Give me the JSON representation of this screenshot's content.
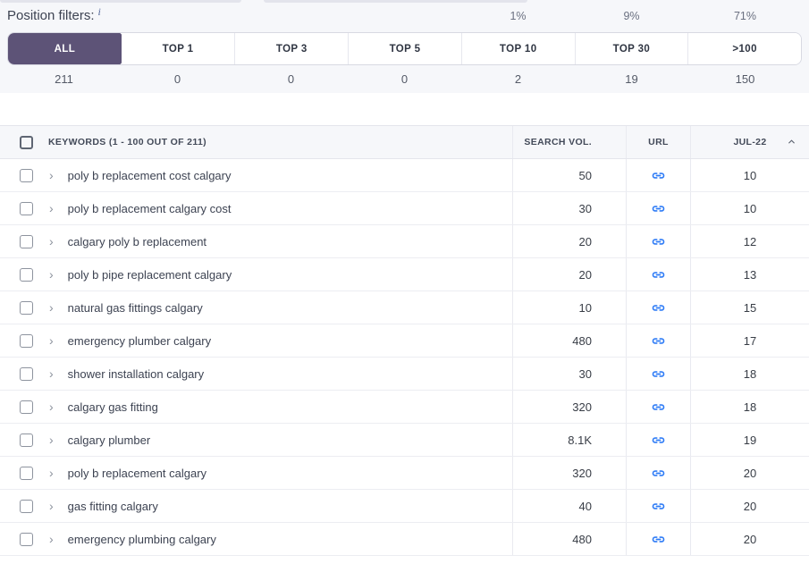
{
  "colors": {
    "accent_purple": "#5d5377",
    "link_blue": "#2f7cf6",
    "green_bg": "#e7f6ec",
    "green_border": "#93d2a4",
    "section_bg": "#f6f7fa"
  },
  "position_filters": {
    "title": "Position filters:",
    "info_icon": "i",
    "tabs": [
      {
        "label": "ALL",
        "percent": "",
        "count": "211",
        "selected": true
      },
      {
        "label": "TOP 1",
        "percent": "",
        "count": "0",
        "selected": false
      },
      {
        "label": "TOP 3",
        "percent": "",
        "count": "0",
        "selected": false
      },
      {
        "label": "TOP 5",
        "percent": "",
        "count": "0",
        "selected": false
      },
      {
        "label": "TOP 10",
        "percent": "1%",
        "count": "2",
        "selected": false
      },
      {
        "label": "TOP 30",
        "percent": "9%",
        "count": "19",
        "selected": false
      },
      {
        "label": ">100",
        "percent": "71%",
        "count": "150",
        "selected": false
      }
    ]
  },
  "table": {
    "header": {
      "keywords": "KEYWORDS (1 - 100 OUT OF 211)",
      "search_vol": "SEARCH VOL.",
      "url": "URL",
      "date": "JUL-22"
    },
    "rows": [
      {
        "keyword": "poly b replacement cost calgary",
        "search_vol": "50",
        "position": "10",
        "pos_style": "pos-green-border",
        "hover": true
      },
      {
        "keyword": "poly b replacement calgary cost",
        "search_vol": "30",
        "position": "10",
        "pos_style": "pos-green",
        "hover": false
      },
      {
        "keyword": "calgary poly b replacement",
        "search_vol": "20",
        "position": "12",
        "pos_style": "pos-plain",
        "hover": false
      },
      {
        "keyword": "poly b pipe replacement calgary",
        "search_vol": "20",
        "position": "13",
        "pos_style": "pos-plain",
        "hover": false
      },
      {
        "keyword": "natural gas fittings calgary",
        "search_vol": "10",
        "position": "15",
        "pos_style": "pos-plain",
        "hover": false
      },
      {
        "keyword": "emergency plumber calgary",
        "search_vol": "480",
        "position": "17",
        "pos_style": "pos-plain",
        "hover": false
      },
      {
        "keyword": "shower installation calgary",
        "search_vol": "30",
        "position": "18",
        "pos_style": "pos-plain",
        "hover": false
      },
      {
        "keyword": "calgary gas fitting",
        "search_vol": "320",
        "position": "18",
        "pos_style": "pos-plain",
        "hover": false
      },
      {
        "keyword": "calgary plumber",
        "search_vol": "8.1K",
        "position": "19",
        "pos_style": "pos-plain",
        "hover": false
      },
      {
        "keyword": "poly b replacement calgary",
        "search_vol": "320",
        "position": "20",
        "pos_style": "pos-plain",
        "hover": false
      },
      {
        "keyword": "gas fitting calgary",
        "search_vol": "40",
        "position": "20",
        "pos_style": "pos-plain",
        "hover": false
      },
      {
        "keyword": "emergency plumbing calgary",
        "search_vol": "480",
        "position": "20",
        "pos_style": "pos-plain",
        "hover": false
      }
    ]
  }
}
